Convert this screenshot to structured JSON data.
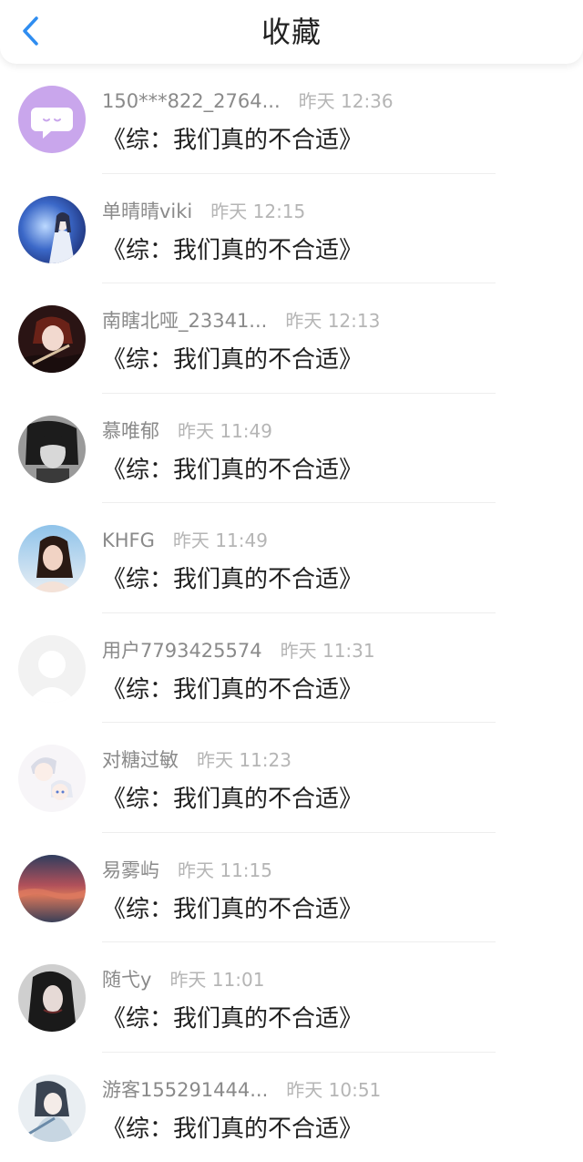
{
  "header": {
    "title": "收藏",
    "back_icon": "chevron-left-icon",
    "accent": "#2f8df0"
  },
  "items": [
    {
      "user": "150***822_2764...",
      "time": "昨天 12:36",
      "work": "《综：我们真的不合适》",
      "avatar": "message-bubble"
    },
    {
      "user": "单晴晴viki",
      "time": "昨天 12:15",
      "work": "《综：我们真的不合适》",
      "avatar": "blue-fantasy"
    },
    {
      "user": "南瞎北哑_23341...",
      "time": "昨天 12:13",
      "work": "《综：我们真的不合适》",
      "avatar": "dark-anime"
    },
    {
      "user": "慕唯郁",
      "time": "昨天 11:49",
      "work": "《综：我们真的不合适》",
      "avatar": "mono-anime"
    },
    {
      "user": "KHFG",
      "time": "昨天 11:49",
      "work": "《综：我们真的不合适》",
      "avatar": "portrait-photo"
    },
    {
      "user": "用户7793425574",
      "time": "昨天 11:31",
      "work": "《综：我们真的不合适》",
      "avatar": "default-person"
    },
    {
      "user": "对糖过敏",
      "time": "昨天 11:23",
      "work": "《综：我们真的不合适》",
      "avatar": "chibi-anime"
    },
    {
      "user": "易雾屿",
      "time": "昨天 11:15",
      "work": "《综：我们真的不合适》",
      "avatar": "sunset-clouds"
    },
    {
      "user": "随弋y",
      "time": "昨天 11:01",
      "work": "《综：我们真的不合适》",
      "avatar": "dark-portrait"
    },
    {
      "user": "游客155291444...",
      "time": "昨天 10:51",
      "work": "《综：我们真的不合适》",
      "avatar": "ink-anime"
    }
  ]
}
